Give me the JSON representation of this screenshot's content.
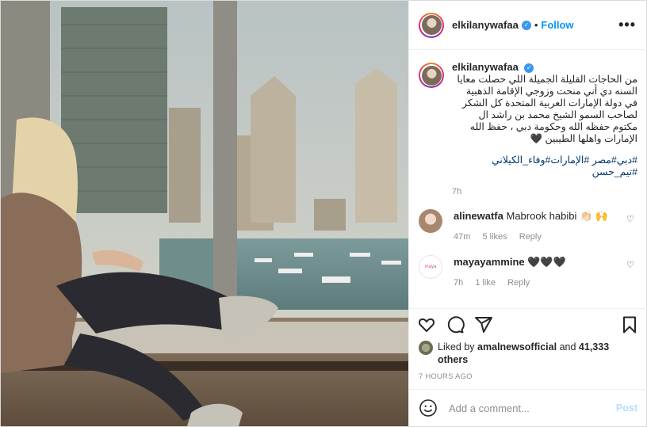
{
  "header": {
    "username": "elkilanywafaa",
    "separator": "•",
    "follow_label": "Follow",
    "more_label": "•••"
  },
  "caption": {
    "username": "elkilanywafaa",
    "text": "من الحاجات القليلة الجميلة اللي حصلت معايا السنه دي أني منحت وزوجي الإقامة الذهبية في دولة الإمارات العربية المتحدة كل الشكر لصاحب السمو الشيخ محمد بن راشد ال مكتوم حفظه الله وحكومة دبي ، حفظ الله الإمارات واهلها الطيبين 🖤",
    "hashtags": "#دبي#مصر #الإمارات#وفاء_الكيلاني #تيم_حسن",
    "time": "7h"
  },
  "comments": [
    {
      "username": "alinewatfa",
      "text": "Mabrook habibi 👏🏻 🙌",
      "time": "47m",
      "likes": "5 likes",
      "reply": "Reply"
    },
    {
      "username": "mayayammine",
      "text": "🖤🖤🖤",
      "time": "7h",
      "likes": "1 like",
      "reply": "Reply"
    }
  ],
  "icons": {
    "like": "heart-icon",
    "comment": "comment-icon",
    "share": "share-icon",
    "save": "bookmark-icon",
    "emoji": "emoji-icon"
  },
  "likes": {
    "prefix": "Liked by",
    "user": "amalnewsofficial",
    "and": "and",
    "others": "41,333 others"
  },
  "timestamp": "7 HOURS AGO",
  "add_comment": {
    "placeholder": "Add a comment...",
    "post_label": "Post"
  },
  "colors": {
    "link": "#0095f6",
    "verified": "#3897f0",
    "post_disabled": "#b2dffc",
    "muted": "#8e8e8e"
  }
}
